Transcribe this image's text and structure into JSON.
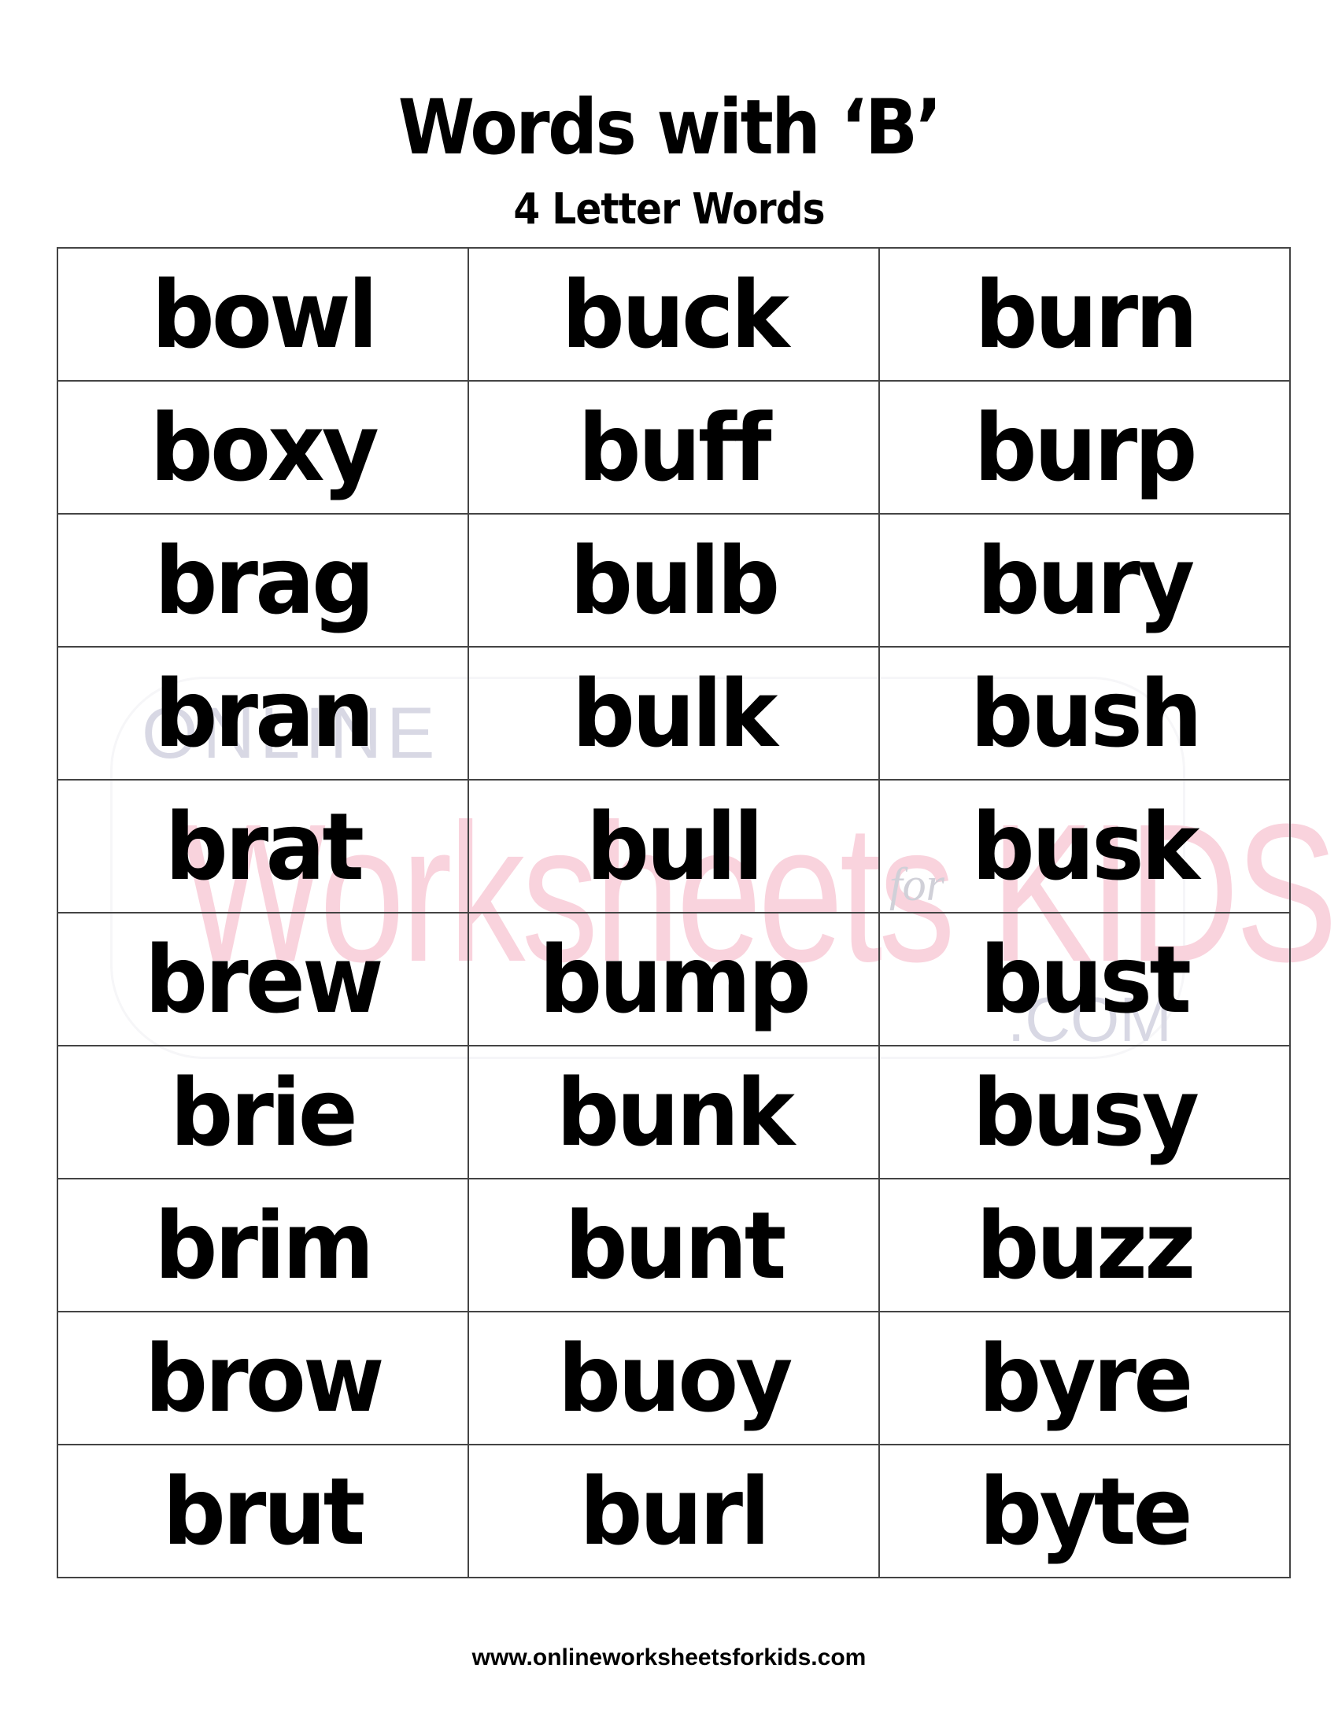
{
  "header": {
    "title": "Words with ‘B’",
    "subtitle": "4 Letter Words"
  },
  "watermark": {
    "line1": "ONLINE",
    "line2": "Worksheets",
    "for": "for",
    "line3": "KIDS",
    "line4": ".COM",
    "colors": {
      "pink": "#f9d3dd",
      "grey": "#d8d8e4"
    }
  },
  "table": {
    "rows": [
      [
        "bowl",
        "buck",
        "burn"
      ],
      [
        "boxy",
        "buff",
        "burp"
      ],
      [
        "brag",
        "bulb",
        "bury"
      ],
      [
        "bran",
        "bulk",
        "bush"
      ],
      [
        "brat",
        "bull",
        "busk"
      ],
      [
        "brew",
        "bump",
        "bust"
      ],
      [
        "brie",
        "bunk",
        "busy"
      ],
      [
        "brim",
        "bunt",
        "buzz"
      ],
      [
        "brow",
        "buoy",
        "byre"
      ],
      [
        "brut",
        "burl",
        "byte"
      ]
    ]
  },
  "footer": {
    "url": "www.onlineworksheetsforkids.com"
  }
}
